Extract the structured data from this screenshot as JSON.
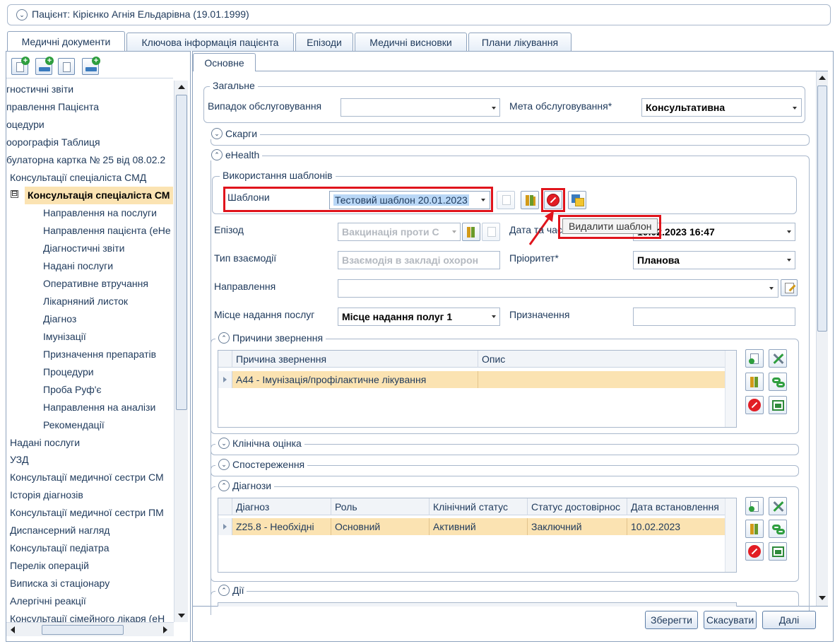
{
  "patient": {
    "title": "Пацієнт: Кірієнко Агнія Ельдарівна (19.01.1999)"
  },
  "tabs": [
    {
      "label": "Медичні документи"
    },
    {
      "label": "Ключова інформація пацієнта"
    },
    {
      "label": "Епізоди"
    },
    {
      "label": "Медичні висновки"
    },
    {
      "label": "Плани лікування"
    }
  ],
  "tree": {
    "items": [
      "гностичні звіти",
      "правлення Пацієнта",
      "оцедури",
      "оорографія Таблиця",
      "булаторна картка № 25 від 08.02.2",
      "Консультації спеціаліста СМД",
      "Консультація спеціаліста СМ",
      "Направлення на послуги",
      "Направлення пацієнта (еНе",
      "Діагностичні звіти",
      "Надані послуги",
      "Оперативне втручання",
      "Лікарняний листок",
      "Діагноз",
      "Імунізації",
      "Призначення препаратів",
      "Процедури",
      "Проба Руф'є",
      "Направлення на аналізи",
      "Рекомендації",
      "Надані послуги",
      "УЗД",
      "Консультації медичної сестри СМ",
      "Історія діагнозів",
      "Консультації медичної сестри ПМ",
      "Диспансерний нагляд",
      "Консультації педіатра",
      "Перелік операцій",
      "Виписка зі стаціонару",
      "Алергічні реакції",
      "Консультації сімейного лікаря (еН"
    ],
    "expander_symbol": "⊟"
  },
  "inner_tab": {
    "label": "Основне"
  },
  "general": {
    "title": "Загальне",
    "case_label": "Випадок обслуговування",
    "case_value": "",
    "purpose_label": "Мета обслуговування*",
    "purpose_value": "Консультативна"
  },
  "complaints": {
    "title": "Скарги"
  },
  "ehealth": {
    "title": "eHealth",
    "templates_group": "Використання шаблонів",
    "templates_label": "Шаблони",
    "templates_value": "Тестовий шаблон 20.01.2023",
    "tooltip": "Видалити шаблон",
    "episode_label": "Епізод",
    "episode_value": "Вакцинація проти С",
    "date_label": "Дата та час",
    "date_value": "10.02.2023 16:47",
    "interaction_label": "Тип взаємодії",
    "interaction_value": "Взаємодія в закладі охорон",
    "priority_label": "Пріоритет*",
    "priority_value": "Планова",
    "referral_label": "Направлення",
    "referral_value": "",
    "place_label": "Місце надання послуг",
    "place_value": "Місце надання полуг 1",
    "assignment_label": "Призначення",
    "assignment_value": ""
  },
  "reasons": {
    "title": "Причини звернення",
    "columns": [
      "Причина звернення",
      "Опис"
    ],
    "rows": [
      [
        "A44 - Імунізація/профілактичне лікування",
        ""
      ]
    ]
  },
  "clinical": {
    "title": "Клінічна оцінка"
  },
  "observations": {
    "title": "Спостереження"
  },
  "diagnoses": {
    "title": "Діагнози",
    "columns": [
      "Діагноз",
      "Роль",
      "Клінічний статус",
      "Статус достовірнос",
      "Дата встановлення"
    ],
    "rows": [
      [
        "Z25.8 - Необхідні",
        "Основний",
        "Активний",
        "Заключний",
        "10.02.2023"
      ]
    ]
  },
  "actions": {
    "title": "Дії"
  },
  "buttons": {
    "save": "Зберегти",
    "cancel": "Скасувати",
    "next": "Далі"
  },
  "colors": {
    "accent": "#1e395b",
    "selection": "#fbe3b2",
    "highlight": "#e0141c"
  }
}
